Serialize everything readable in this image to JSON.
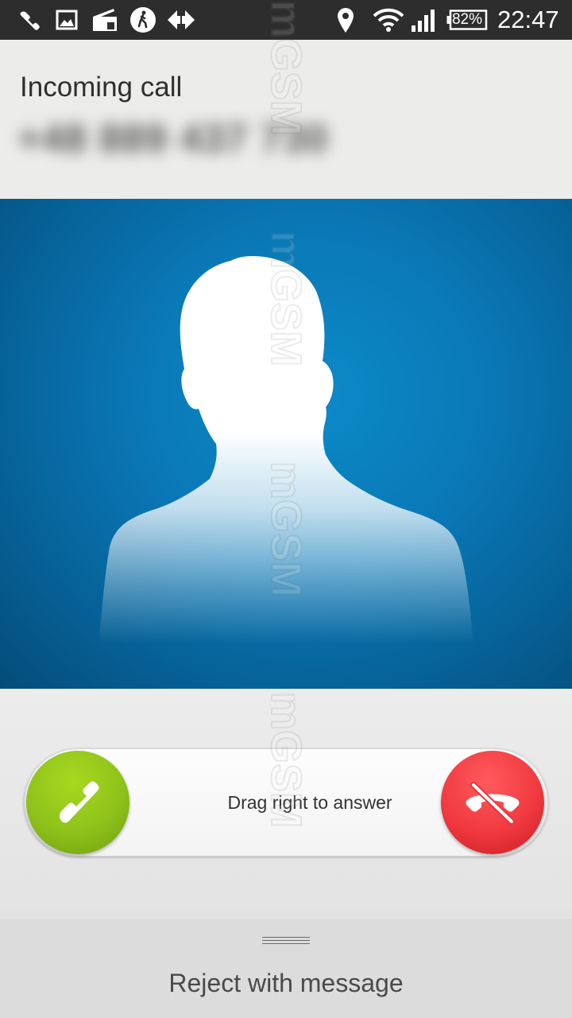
{
  "status_bar": {
    "icons": [
      "phone-icon",
      "image-icon",
      "radio-icon",
      "walk-icon",
      "data-transfer-icon",
      "location-icon",
      "wifi-icon",
      "signal-icon"
    ],
    "battery_percent": "82%",
    "time": "22:47"
  },
  "call": {
    "title": "Incoming call",
    "number": "+48 889 437 730"
  },
  "contact_photo": {
    "placeholder": "contact-silhouette"
  },
  "slider": {
    "hint": "Drag right to answer",
    "answer_icon": "phone-answer-icon",
    "reject_icon": "phone-reject-icon"
  },
  "reject_message": {
    "label": "Reject with message"
  },
  "watermark": {
    "text": "mGSM",
    "repeat": [
      "mGSM",
      "mGSM",
      "mGSM",
      "mGSM"
    ]
  },
  "colors": {
    "status_bar_bg": "#2d2d2d",
    "header_bg": "#ececea",
    "photo_blue": "#0a78b6",
    "answer_green": "#8ec21a",
    "reject_red": "#f03a3f"
  }
}
